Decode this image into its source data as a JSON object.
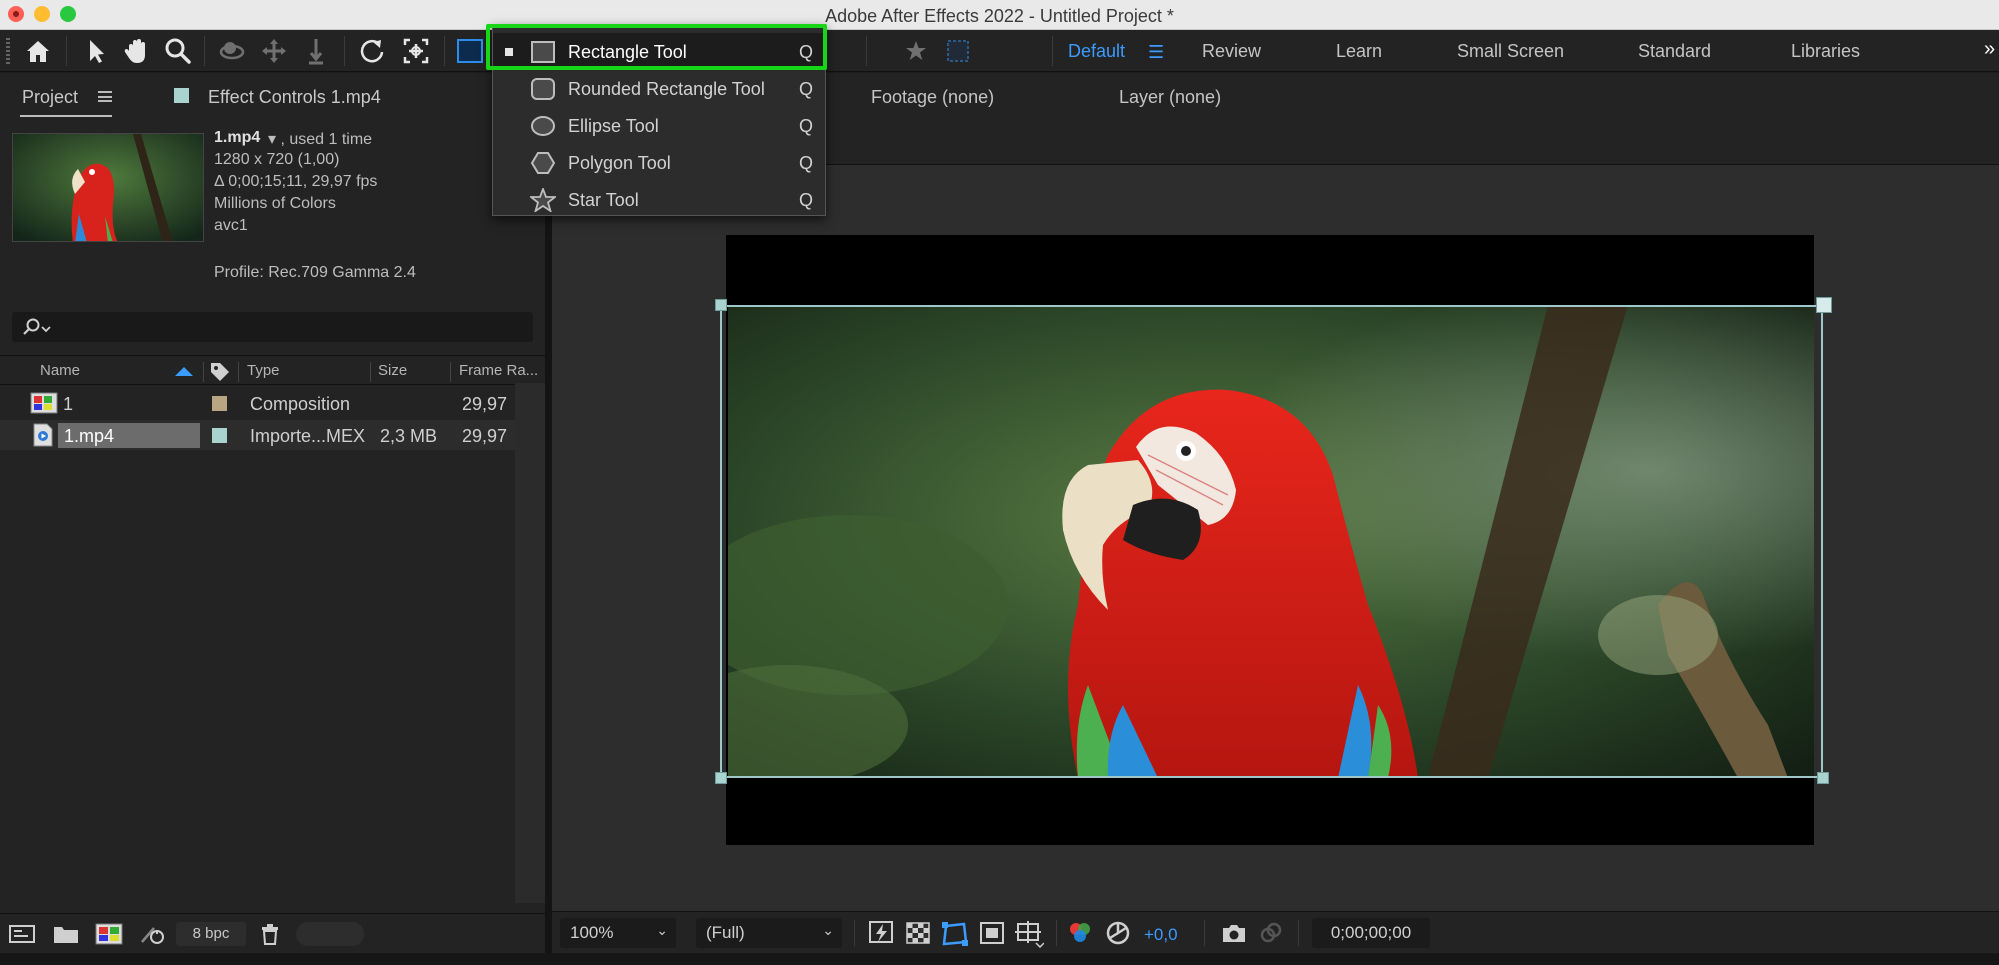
{
  "window": {
    "title": "Adobe After Effects 2022 - Untitled Project *"
  },
  "toolbar": {
    "tools": [
      "home-icon",
      "selection-arrow-icon",
      "hand-icon",
      "zoom-icon",
      "orbit-camera-icon",
      "pan-camera-icon",
      "dolly-camera-icon",
      "rotate-icon",
      "anchor-point-icon",
      "rectangle-icon"
    ],
    "workspaces": [
      {
        "label": "Default",
        "active": true
      },
      {
        "label": "Review",
        "active": false
      },
      {
        "label": "Learn",
        "active": false
      },
      {
        "label": "Small Screen",
        "active": false
      },
      {
        "label": "Standard",
        "active": false
      },
      {
        "label": "Libraries",
        "active": false
      }
    ],
    "more_glyph": "»"
  },
  "shape_menu": {
    "items": [
      {
        "label": "Rectangle Tool",
        "shortcut": "Q",
        "selected": true,
        "icon": "rectangle-icon"
      },
      {
        "label": "Rounded Rectangle Tool",
        "shortcut": "Q",
        "selected": false,
        "icon": "rounded-rectangle-icon"
      },
      {
        "label": "Ellipse Tool",
        "shortcut": "Q",
        "selected": false,
        "icon": "ellipse-icon"
      },
      {
        "label": "Polygon Tool",
        "shortcut": "Q",
        "selected": false,
        "icon": "polygon-icon"
      },
      {
        "label": "Star Tool",
        "shortcut": "Q",
        "selected": false,
        "icon": "star-icon"
      }
    ],
    "highlight_color": "#17d617"
  },
  "project_panel": {
    "tab_project": "Project",
    "tab_effect_controls": "Effect Controls 1.mp4",
    "footage": {
      "name": "1.mp4",
      "used": "▾ , used 1 time",
      "resolution": "1280 x 720 (1,00)",
      "duration": "Δ 0;00;15;11, 29,97 fps",
      "colors": "Millions of Colors",
      "codec": "avc1",
      "profile": "Profile: Rec.709 Gamma 2.4"
    },
    "columns": {
      "name": "Name",
      "type": "Type",
      "size": "Size",
      "frame_rate": "Frame Ra..."
    },
    "rows": [
      {
        "name": "1",
        "type": "Composition",
        "size": "",
        "frame_rate": "29,97",
        "label_color": "#b9a582",
        "icon": "composition-icon"
      },
      {
        "name": "1.mp4",
        "type": "Importe...MEX",
        "size": "2,3 MB",
        "frame_rate": "29,97",
        "label_color": "#a8d3cf",
        "icon": "footage-file-icon"
      }
    ],
    "bpc": "8 bpc"
  },
  "viewer": {
    "footage_label": "Footage (none)",
    "layer_label": "Layer (none)",
    "magnification": "100%",
    "resolution": "(Full)",
    "exposure": "+0,0",
    "timecode": "0;00;00;00"
  },
  "colors": {
    "accent": "#3b9bff",
    "panel_bg": "#232323",
    "canvas_bg": "#2d2d2d"
  }
}
